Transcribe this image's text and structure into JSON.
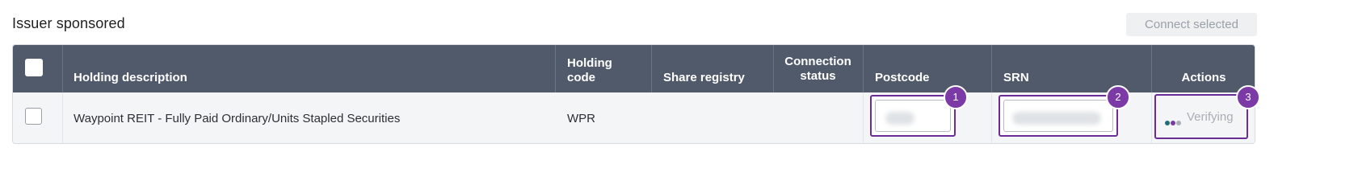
{
  "section": {
    "title": "Issuer sponsored",
    "connect_button": "Connect selected"
  },
  "table": {
    "headers": {
      "holding_description": "Holding description",
      "holding_code_line1": "Holding",
      "holding_code_line2": "code",
      "share_registry": "Share registry",
      "connection_status_line1": "Connection",
      "connection_status_line2": "status",
      "postcode": "Postcode",
      "srn": "SRN",
      "actions": "Actions"
    },
    "rows": [
      {
        "holding_description": "Waypoint REIT - Fully Paid Ordinary/Units Stapled Securities",
        "holding_code": "WPR",
        "share_registry": "",
        "connection_status": "",
        "action_status": "Verifying"
      }
    ]
  },
  "annotations": {
    "postcode_badge": "1",
    "srn_badge": "2",
    "actions_badge": "3"
  },
  "colors": {
    "header_bg": "#515a6b",
    "highlight": "#6a2c96",
    "badge": "#7b3aa6",
    "dot_teal": "#1e6f73",
    "dot_purple": "#7b3aa6",
    "dot_grey": "#a9aeb5"
  },
  "icons": {
    "verifying_indicator": "loading-dots-icon"
  }
}
